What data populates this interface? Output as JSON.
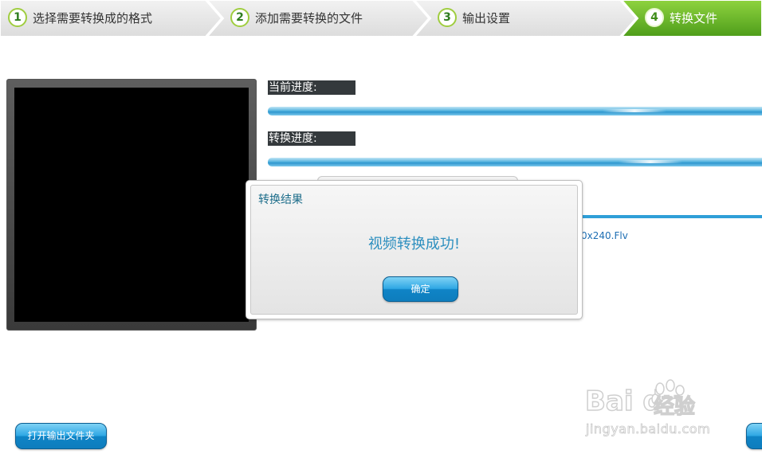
{
  "steps": [
    {
      "num": "1",
      "label": "选择需要转换成的格式",
      "active": false
    },
    {
      "num": "2",
      "label": "添加需要转换的文件",
      "active": false
    },
    {
      "num": "3",
      "label": "输出设置",
      "active": false
    },
    {
      "num": "4",
      "label": "转换文件",
      "active": true
    }
  ],
  "progress": {
    "current_label": "当前进度:",
    "total_label": "转换进度:"
  },
  "file_name_partial": "0x240.Flv",
  "dialog": {
    "title": "转换结果",
    "message": "视频转换成功!",
    "confirm_label": "确定"
  },
  "buttons": {
    "open_folder": "打开输出文件夹"
  },
  "watermark": {
    "logo": "Bai du",
    "jingyan": "经验",
    "url": "jingyan.baidu.com"
  },
  "colors": {
    "step_bg": "#e6e6e6",
    "step_active": "#6cb92a",
    "accent_blue": "#2fa7e4",
    "dialog_text": "#2d8fbf",
    "label_bg": "#34393c"
  }
}
